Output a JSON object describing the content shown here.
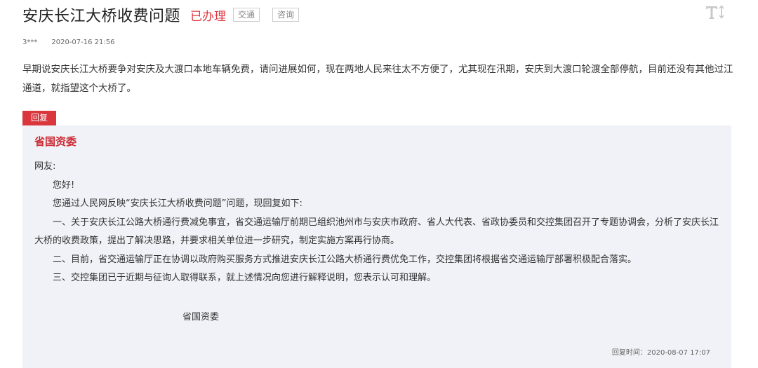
{
  "header": {
    "title": "安庆长江大桥收费问题",
    "status": "已办理",
    "tags": [
      "交通",
      "咨询"
    ],
    "font_toggle_icon": "font-size-icon"
  },
  "meta": {
    "user": "3***",
    "datetime": "2020-07-16 21:56"
  },
  "question": {
    "text": "早期说安庆长江大桥要争对安庆及大渡口本地车辆免费，请问进展如何，现在两地人民来往太不方便了，尤其现在汛期，安庆到大渡口轮渡全部停航，目前还没有其他过江通道，就指望这个大桥了。"
  },
  "reply": {
    "tab_label": "回复",
    "responder": "省国资委",
    "greeting": "网友:",
    "paragraphs": [
      "您好!",
      "您通过人民网反映“安庆长江大桥收费问题”问题，现回复如下:",
      "一、关于安庆长江公路大桥通行费减免事宜，省交通运输厅前期已组织池州市与安庆市政府、省人大代表、省政协委员和交控集团召开了专题协调会，分析了安庆长江大桥的收费政策，提出了解决思路，并要求相关单位进一步研究，制定实施方案再行协商。",
      "二、目前，省交通运输厅正在协调以政府购买服务方式推进安庆长江公路大桥通行费优免工作，交控集团将根据省交通运输厅部署积极配合落实。",
      "三、交控集团已于近期与征询人取得联系，就上述情况向您进行解释说明，您表示认可和理解。"
    ],
    "signature": "省国资委",
    "reply_time": "回复时间：2020-08-07 17:07"
  },
  "colors": {
    "status_red": "#e0373d",
    "tab_red": "#d9363e",
    "responder_red": "#cc2b33",
    "reply_background": "#f1f2f7"
  }
}
